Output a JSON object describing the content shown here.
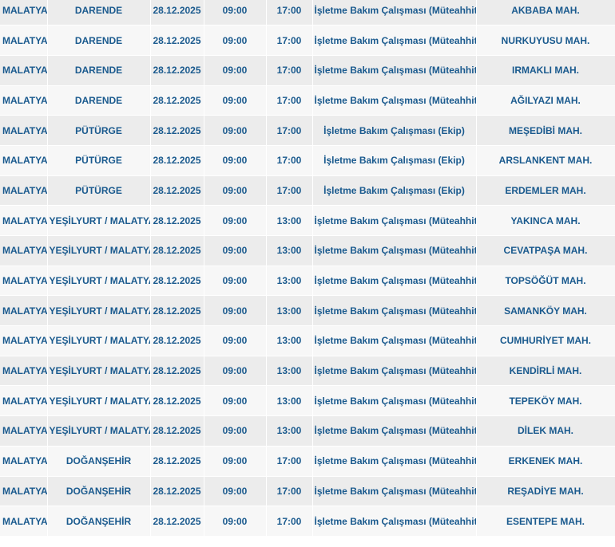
{
  "table": {
    "rows": [
      {
        "city": "MALATYA",
        "district": "DARENDE",
        "date": "28.12.2025",
        "start": "09:00",
        "end": "17:00",
        "work": "İşletme Bakım Çalışması (Müteahhit)",
        "neighborhood": "AKBABA MAH."
      },
      {
        "city": "MALATYA",
        "district": "DARENDE",
        "date": "28.12.2025",
        "start": "09:00",
        "end": "17:00",
        "work": "İşletme Bakım Çalışması (Müteahhit)",
        "neighborhood": "NURKUYUSU MAH."
      },
      {
        "city": "MALATYA",
        "district": "DARENDE",
        "date": "28.12.2025",
        "start": "09:00",
        "end": "17:00",
        "work": "İşletme Bakım Çalışması (Müteahhit)",
        "neighborhood": "IRMAKLI MAH."
      },
      {
        "city": "MALATYA",
        "district": "DARENDE",
        "date": "28.12.2025",
        "start": "09:00",
        "end": "17:00",
        "work": "İşletme Bakım Çalışması (Müteahhit)",
        "neighborhood": "AĞILYAZI MAH."
      },
      {
        "city": "MALATYA",
        "district": "PÜTÜRGE",
        "date": "28.12.2025",
        "start": "09:00",
        "end": "17:00",
        "work": "İşletme Bakım Çalışması (Ekip)",
        "neighborhood": "MEŞEDİBİ MAH."
      },
      {
        "city": "MALATYA",
        "district": "PÜTÜRGE",
        "date": "28.12.2025",
        "start": "09:00",
        "end": "17:00",
        "work": "İşletme Bakım Çalışması (Ekip)",
        "neighborhood": "ARSLANKENT MAH."
      },
      {
        "city": "MALATYA",
        "district": "PÜTÜRGE",
        "date": "28.12.2025",
        "start": "09:00",
        "end": "17:00",
        "work": "İşletme Bakım Çalışması (Ekip)",
        "neighborhood": "ERDEMLER MAH."
      },
      {
        "city": "MALATYA",
        "district": "YEŞİLYURT / MALATYA",
        "date": "28.12.2025",
        "start": "09:00",
        "end": "13:00",
        "work": "İşletme Bakım Çalışması (Müteahhit)",
        "neighborhood": "YAKINCA MAH."
      },
      {
        "city": "MALATYA",
        "district": "YEŞİLYURT / MALATYA",
        "date": "28.12.2025",
        "start": "09:00",
        "end": "13:00",
        "work": "İşletme Bakım Çalışması (Müteahhit)",
        "neighborhood": "CEVATPAŞA MAH."
      },
      {
        "city": "MALATYA",
        "district": "YEŞİLYURT / MALATYA",
        "date": "28.12.2025",
        "start": "09:00",
        "end": "13:00",
        "work": "İşletme Bakım Çalışması (Müteahhit)",
        "neighborhood": "TOPSÖĞÜT MAH."
      },
      {
        "city": "MALATYA",
        "district": "YEŞİLYURT / MALATYA",
        "date": "28.12.2025",
        "start": "09:00",
        "end": "13:00",
        "work": "İşletme Bakım Çalışması (Müteahhit)",
        "neighborhood": "SAMANKÖY MAH."
      },
      {
        "city": "MALATYA",
        "district": "YEŞİLYURT / MALATYA",
        "date": "28.12.2025",
        "start": "09:00",
        "end": "13:00",
        "work": "İşletme Bakım Çalışması (Müteahhit)",
        "neighborhood": "CUMHURİYET MAH."
      },
      {
        "city": "MALATYA",
        "district": "YEŞİLYURT / MALATYA",
        "date": "28.12.2025",
        "start": "09:00",
        "end": "13:00",
        "work": "İşletme Bakım Çalışması (Müteahhit)",
        "neighborhood": "KENDİRLİ MAH."
      },
      {
        "city": "MALATYA",
        "district": "YEŞİLYURT / MALATYA",
        "date": "28.12.2025",
        "start": "09:00",
        "end": "13:00",
        "work": "İşletme Bakım Çalışması (Müteahhit)",
        "neighborhood": "TEPEKÖY MAH."
      },
      {
        "city": "MALATYA",
        "district": "YEŞİLYURT / MALATYA",
        "date": "28.12.2025",
        "start": "09:00",
        "end": "13:00",
        "work": "İşletme Bakım Çalışması (Müteahhit)",
        "neighborhood": "DİLEK MAH."
      },
      {
        "city": "MALATYA",
        "district": "DOĞANŞEHİR",
        "date": "28.12.2025",
        "start": "09:00",
        "end": "17:00",
        "work": "İşletme Bakım Çalışması (Müteahhit)",
        "neighborhood": "ERKENEK MAH."
      },
      {
        "city": "MALATYA",
        "district": "DOĞANŞEHİR",
        "date": "28.12.2025",
        "start": "09:00",
        "end": "17:00",
        "work": "İşletme Bakım Çalışması (Müteahhit)",
        "neighborhood": "REŞADİYE MAH."
      },
      {
        "city": "MALATYA",
        "district": "DOĞANŞEHİR",
        "date": "28.12.2025",
        "start": "09:00",
        "end": "17:00",
        "work": "İşletme Bakım Çalışması (Müteahhit)",
        "neighborhood": "ESENTEPE MAH."
      }
    ]
  },
  "colors": {
    "text": "#1a5a8e",
    "row_odd": "#ececec",
    "row_even": "#f7f7f7"
  }
}
